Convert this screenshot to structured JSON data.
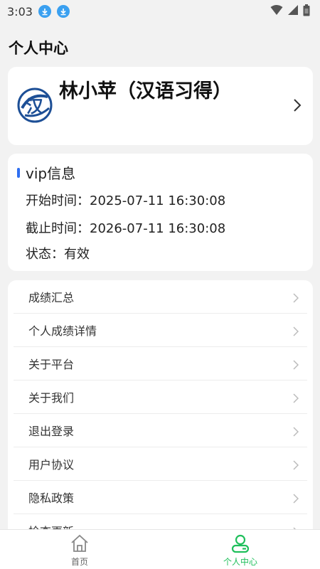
{
  "status_bar": {
    "time": "3:03",
    "icons": [
      "download-icon",
      "download-icon",
      "wifi-icon",
      "signal-icon",
      "battery-icon"
    ]
  },
  "page_title": "个人中心",
  "profile": {
    "logo_icon": "han-logo-icon",
    "name": "林小苹（汉语习得）"
  },
  "vip": {
    "title": "vip信息",
    "start": "开始时间：2025-07-11 16:30:08",
    "end": "截止时间：2026-07-11 16:30:08",
    "status": "状态：有效"
  },
  "menu": {
    "items": [
      {
        "label": "成绩汇总"
      },
      {
        "label": "个人成绩详情"
      },
      {
        "label": "关于平台"
      },
      {
        "label": "关于我们"
      },
      {
        "label": "退出登录"
      },
      {
        "label": "用户协议"
      },
      {
        "label": "隐私政策"
      },
      {
        "label": "检查更新"
      }
    ]
  },
  "tabbar": {
    "tabs": [
      {
        "label": "首页",
        "icon": "home-icon",
        "active": false
      },
      {
        "label": "个人中心",
        "icon": "user-icon",
        "active": true
      }
    ]
  },
  "colors": {
    "accent": "#2f6ff1",
    "active_tab": "#1fbf5b",
    "inactive_tab": "#666666",
    "logo_blue": "#1d4f96"
  }
}
